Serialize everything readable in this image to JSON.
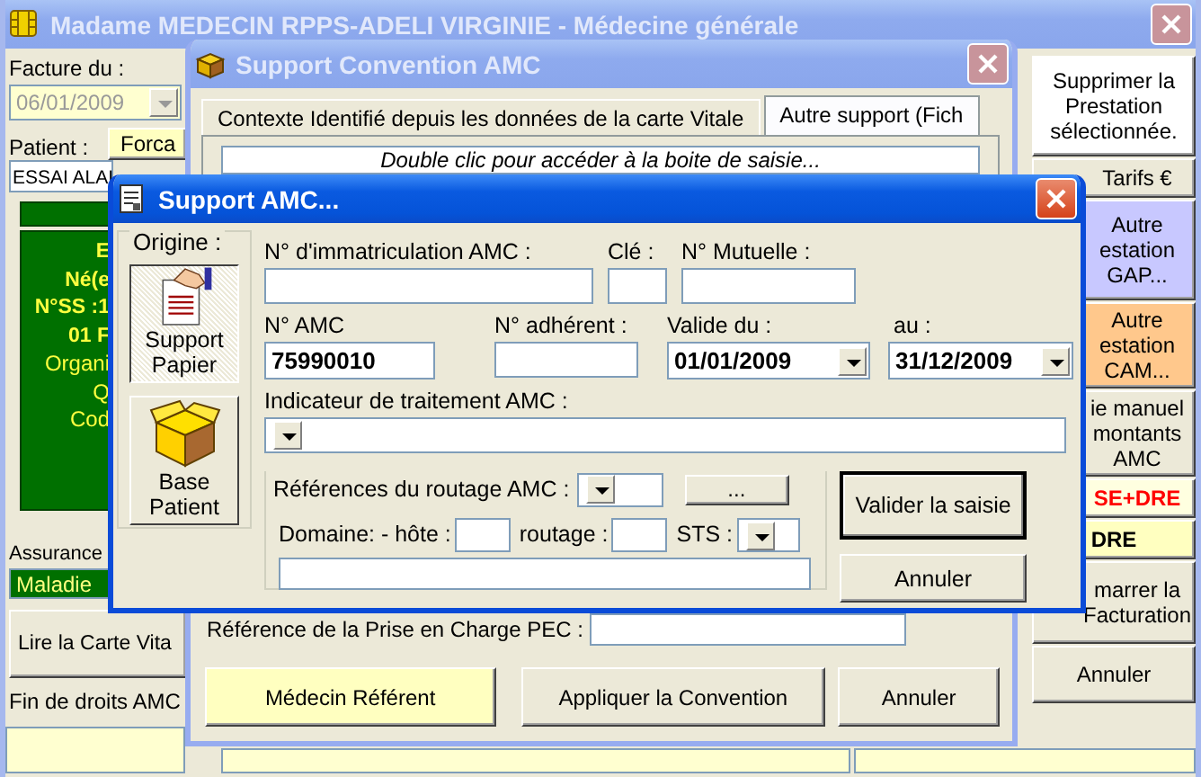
{
  "main_window": {
    "title": "Madame MEDECIN RPPS-ADELI VIRGINIE - Médecine générale",
    "invoice_date": {
      "label": "Facture du :",
      "value": "06/01/2009",
      "disabled": true
    },
    "patient": {
      "label": "Patient :",
      "button": "Forca",
      "value": "ESSAI ALAI"
    },
    "patient_card": [
      {
        "text": "E",
        "kind": "bold"
      },
      {
        "text": "Né(e",
        "kind": "bold"
      },
      {
        "text": "N°SS :1",
        "kind": "bold"
      },
      {
        "text": "01 F",
        "kind": "bold"
      },
      {
        "text": "Organi",
        "kind": "plain"
      },
      {
        "text": "Q",
        "kind": "plain"
      },
      {
        "text": "Cod",
        "kind": "plain"
      }
    ],
    "insurance": {
      "label": "Assurance",
      "value": "Maladie"
    },
    "read_card_button": "Lire la Carte Vita",
    "amc_rights": {
      "label": "Fin de droits AMC"
    },
    "actions": [
      {
        "label": "Supprimer la\nPrestation\nsélectionnée.",
        "color": "#ffffff",
        "kind": "normal"
      },
      {
        "label": "Tarifs €",
        "color": "#ece9d8",
        "kind": "normal"
      },
      {
        "label": "Autre\nestation\nGAP...",
        "color": "#c8c8ff",
        "kind": "normal"
      },
      {
        "label": "Autre\nestation\nCAM...",
        "color": "#ffc88c",
        "kind": "normal"
      },
      {
        "label": "ie manuel\nmontants\nAMC",
        "color": "#ece9d8",
        "kind": "normal"
      },
      {
        "label": "SE+DRE",
        "color": "#ffffe0",
        "kind": "alert"
      },
      {
        "label": "DRE",
        "color": "#ffffc0",
        "kind": "bold"
      },
      {
        "label": "marrer la\nFacturation",
        "color": "#ece9d8",
        "kind": "normal"
      },
      {
        "label": "Annuler",
        "color": "#ece9d8",
        "kind": "normal"
      }
    ]
  },
  "convention_window": {
    "title": "Support Convention AMC",
    "tabs": [
      {
        "label": "Contexte Identifié depuis les données de la carte Vitale",
        "selected": false
      },
      {
        "label": "Autre support (Fich",
        "selected": true
      }
    ],
    "hint_field": "Double clic pour accéder à la boite de saisie...",
    "pec": {
      "label": "Référence de la Prise en Charge PEC :"
    },
    "buttons": [
      {
        "label": "Médecin Référent",
        "color": "#ffffc0"
      },
      {
        "label": "Appliquer la Convention",
        "color": "#ece9d8"
      },
      {
        "label": "Annuler",
        "color": "#ece9d8"
      }
    ]
  },
  "amc_dialog": {
    "title": "Support AMC...",
    "origin": {
      "label": "Origine :",
      "options": [
        {
          "label": "Support\nPapier",
          "kind": "paper",
          "selected": true
        },
        {
          "label": "Base\nPatient",
          "kind": "box",
          "selected": false
        }
      ]
    },
    "immatriculation": {
      "label": "N° d'immatriculation AMC :"
    },
    "key": {
      "label": "Clé :"
    },
    "mutuelle": {
      "label": "N° Mutuelle :"
    },
    "amc_number": {
      "label": "N° AMC",
      "value": "75990010"
    },
    "adherent": {
      "label": "N° adhérent :"
    },
    "valid_from": {
      "label": "Valide du :",
      "value": "01/01/2009"
    },
    "valid_to": {
      "label": "au :",
      "value": "31/12/2009"
    },
    "indicator": {
      "label": "Indicateur de traitement AMC :"
    },
    "routing": {
      "label": "Références du routage AMC :",
      "more_button": "...",
      "domain_label": "Domaine: - hôte :",
      "routage_label": "routage :",
      "sts_label": "STS :"
    },
    "buttons": [
      {
        "label": "Valider la saisie",
        "default": true
      },
      {
        "label": "Annuler",
        "default": false
      }
    ]
  }
}
